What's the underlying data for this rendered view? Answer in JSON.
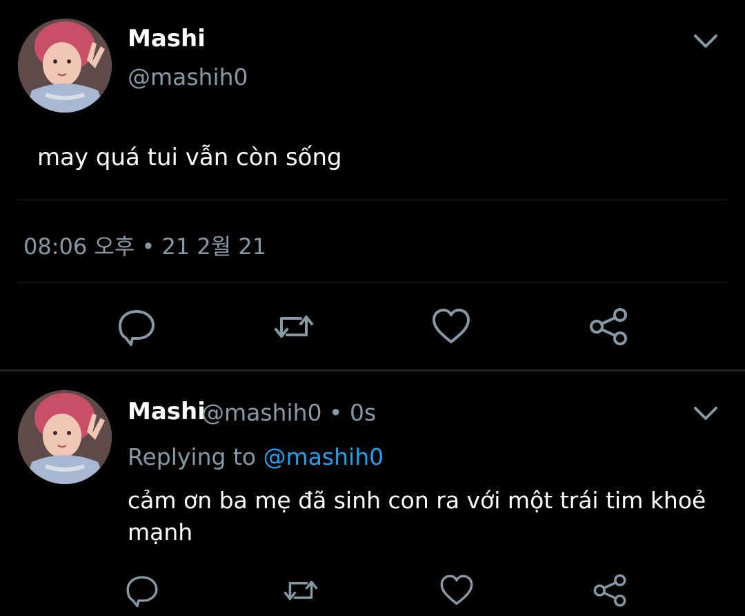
{
  "main_tweet": {
    "display_name": "Mashi",
    "handle": "@mashih0",
    "text": "may quá tui vẫn còn sống",
    "timestamp": "08:06 오후 • 21 2월 21",
    "avatar_icon": "user-avatar",
    "menu_icon": "chevron-down-icon"
  },
  "reply_tweet": {
    "display_name": "Mashi",
    "handle_time": "@mashih0 • 0s",
    "replying_label": "Replying to",
    "replying_handle": "@mashih0",
    "text": "cảm ơn ba mẹ đã sinh con ra với một trái tim khoẻ mạnh",
    "avatar_icon": "user-avatar",
    "menu_icon": "chevron-down-icon"
  },
  "colors": {
    "background": "#000000",
    "primary_text": "#ffffff",
    "secondary_text": "#8899a6",
    "accent": "#1da1f2",
    "divider": "#222a31"
  },
  "actions": [
    "reply-icon",
    "retweet-icon",
    "like-icon",
    "share-icon"
  ]
}
